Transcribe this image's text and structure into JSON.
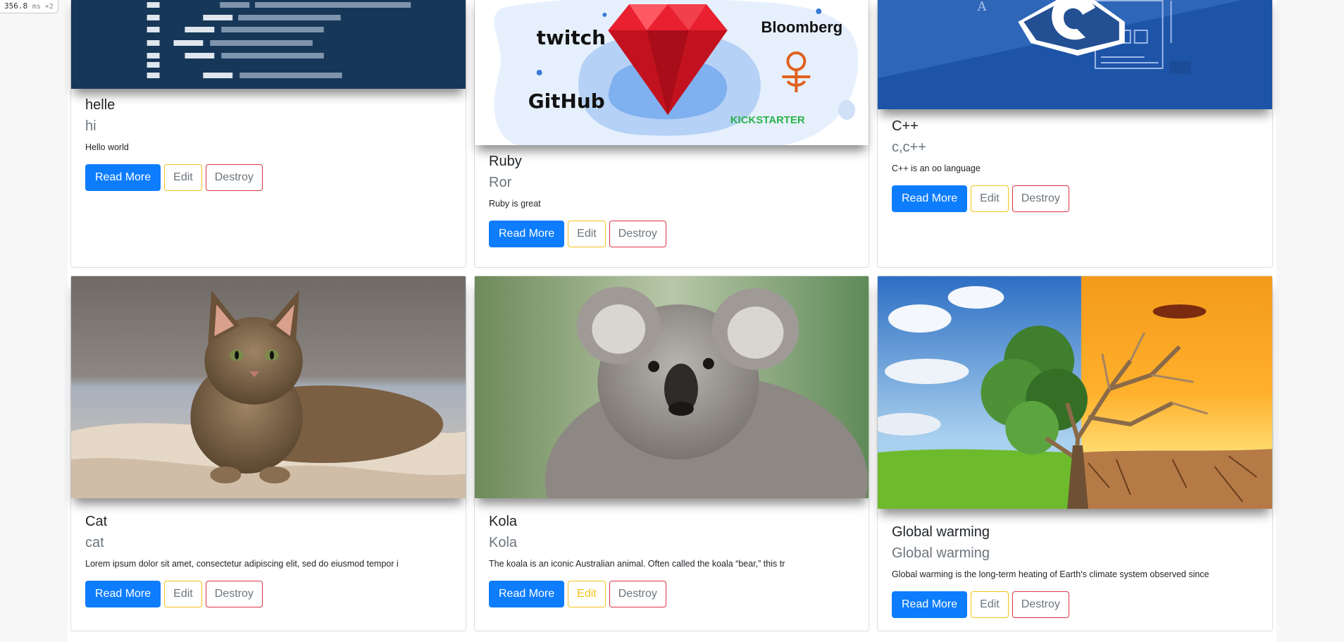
{
  "perf": {
    "value": "356.8",
    "unit": "ms ×2"
  },
  "buttons": {
    "read_more": "Read More",
    "edit": "Edit",
    "destroy": "Destroy"
  },
  "cards": [
    {
      "title": "helle",
      "subtitle": "hi",
      "text": "Hello world",
      "image": "code-editor-illustration"
    },
    {
      "title": "Ruby",
      "subtitle": "Ror",
      "text": "Ruby is great",
      "image": "ruby-gem-with-company-logos",
      "logos": {
        "twitch": "twitch",
        "bloomberg": "Bloomberg",
        "github": "GitHub",
        "kickstarter": "KICKSTARTER"
      }
    },
    {
      "title": "C++",
      "subtitle": "c,c++",
      "text": "C++ is an oo language",
      "image": "cpp-logo-illustration"
    },
    {
      "title": "Cat",
      "subtitle": "cat",
      "text": "Lorem ipsum dolor sit amet, consectetur adipiscing elit, sed do eiusmod tempor i",
      "image": "tabby-cat-photo"
    },
    {
      "title": "Kola",
      "subtitle": "Kola",
      "text": "The koala is an iconic Australian animal. Often called the koala “bear,” this tr",
      "image": "koala-photo"
    },
    {
      "title": "Global warming",
      "subtitle": "Global warming",
      "text": "Global warming is the long-term heating of Earth's climate system observed since",
      "image": "half-green-half-dead-tree-photo"
    }
  ],
  "colors": {
    "primary": "#0d7dfd",
    "warning": "#f4c318",
    "danger": "#dc3545",
    "muted": "#6c757d"
  }
}
